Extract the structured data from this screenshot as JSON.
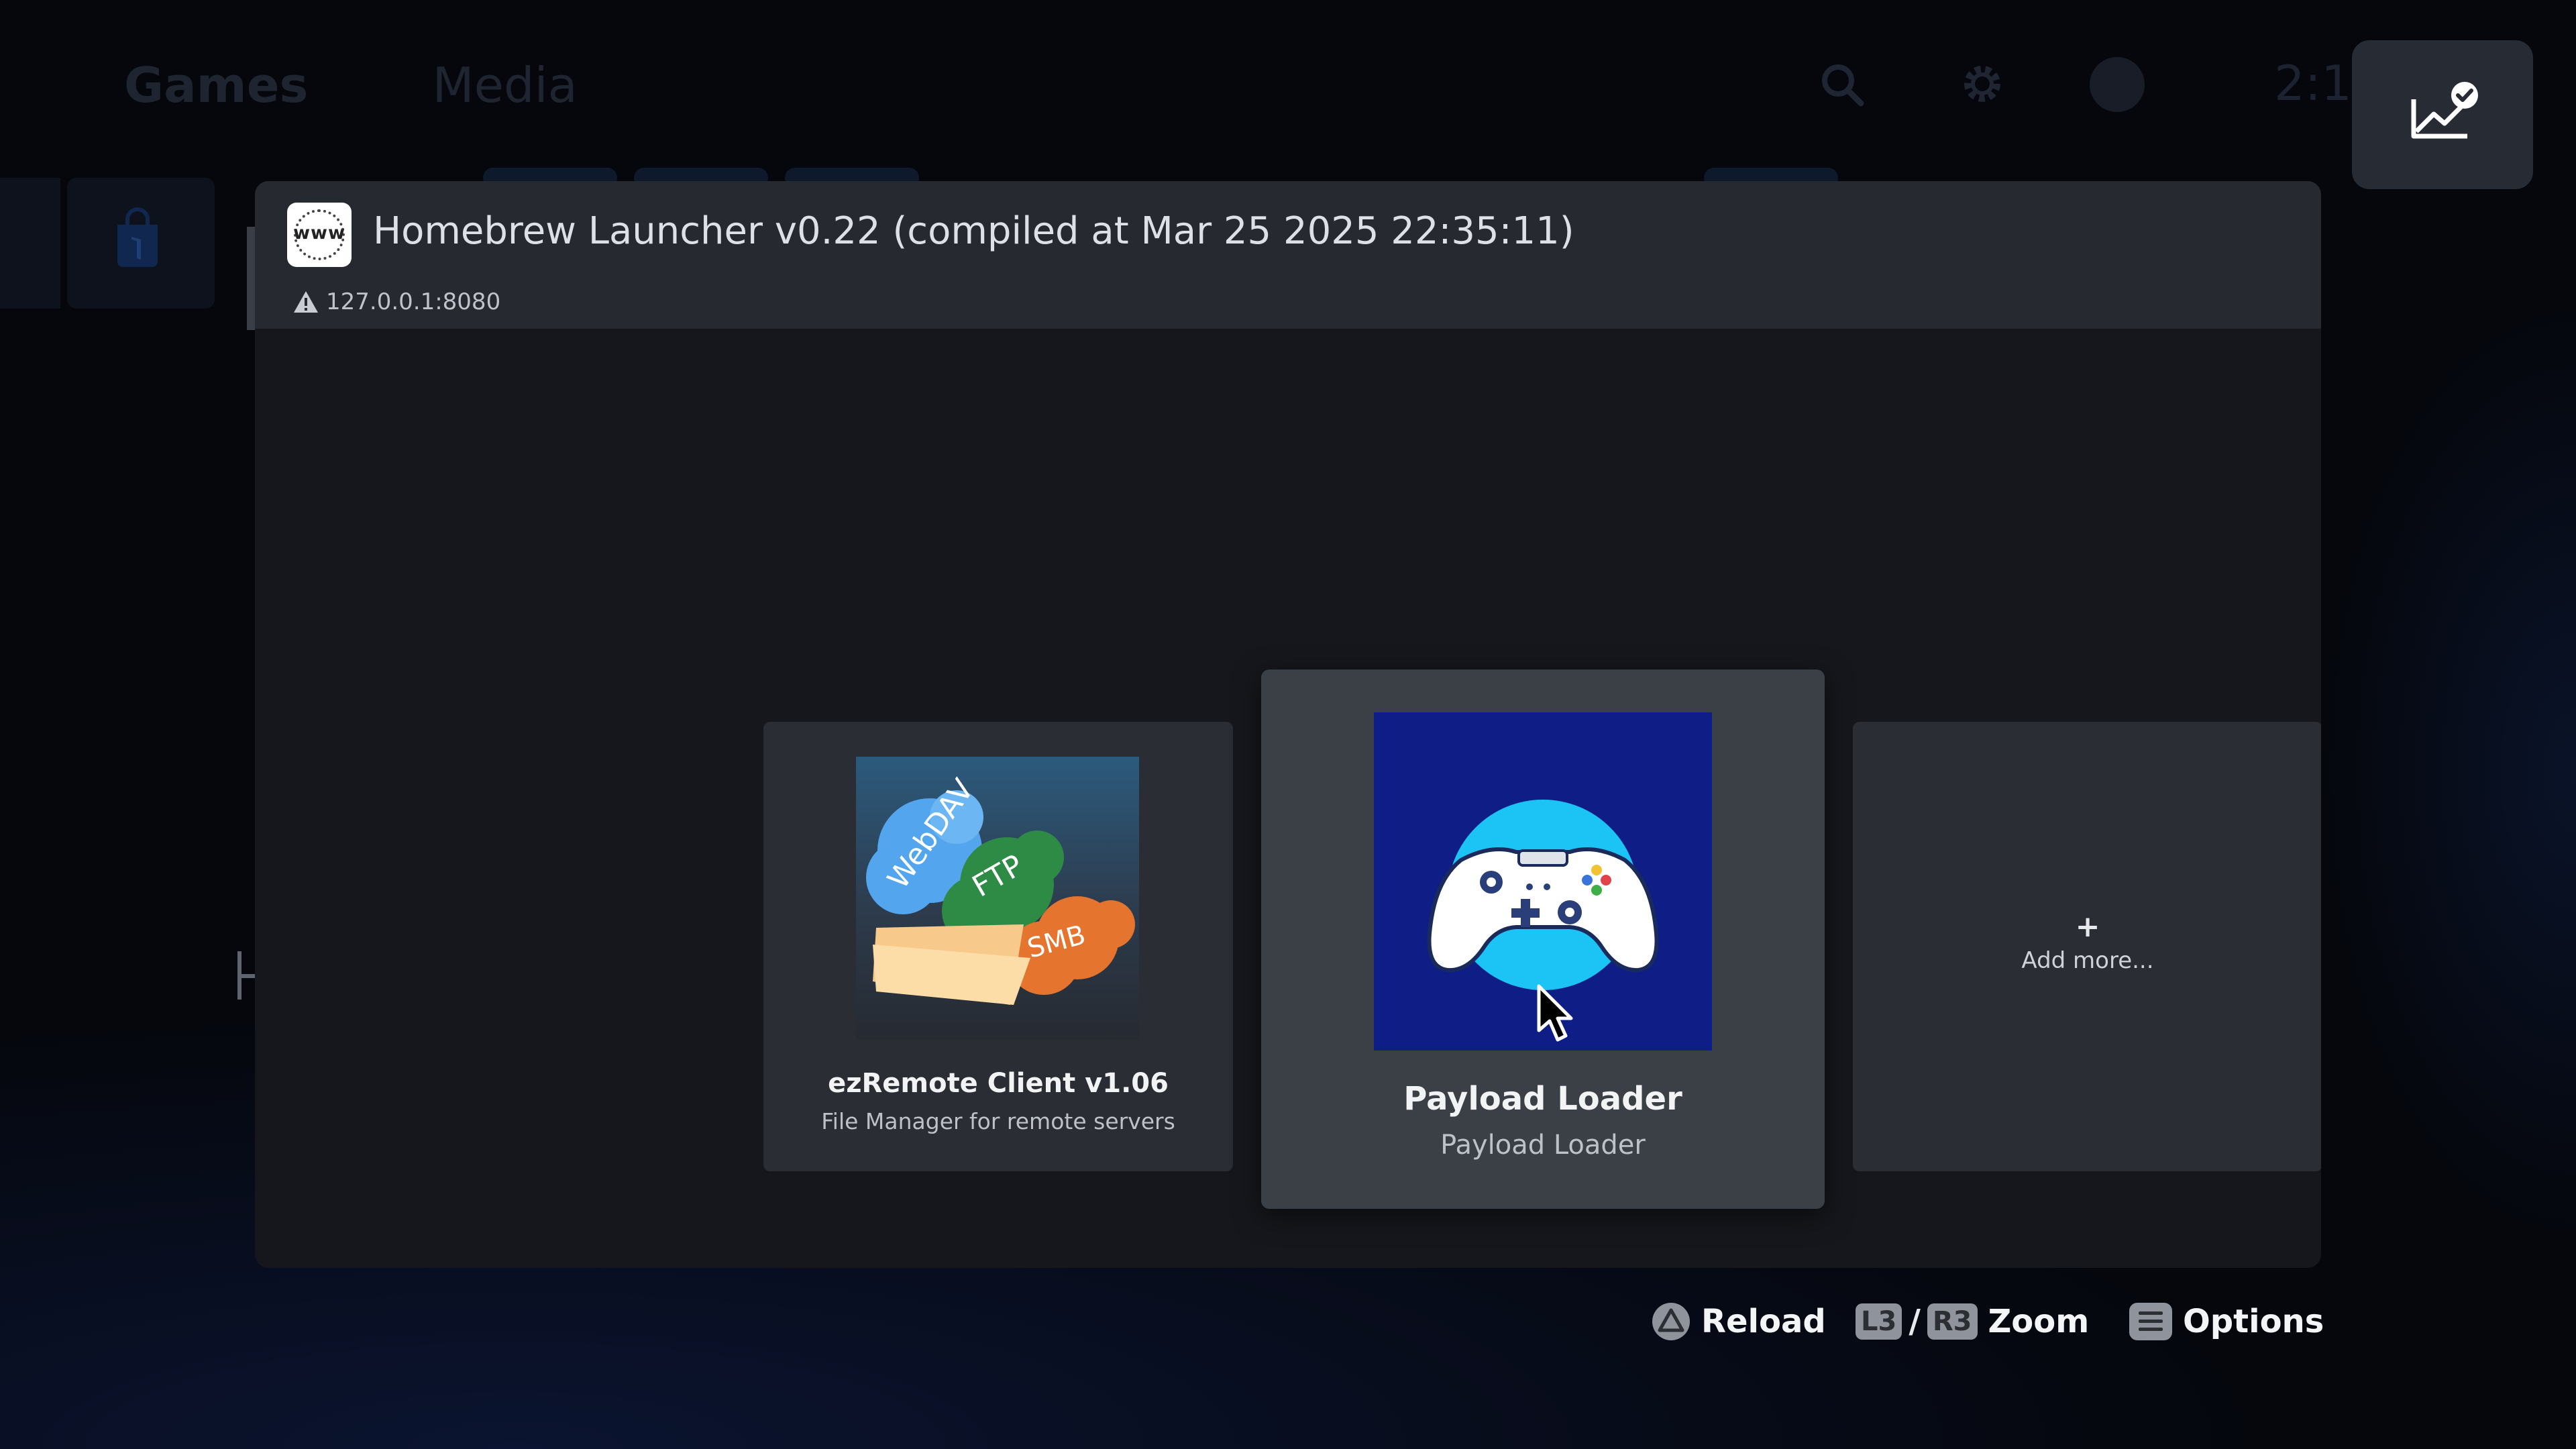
{
  "background": {
    "nav": {
      "games": "Games",
      "media": "Media"
    },
    "clock": "2:1"
  },
  "status_button": {
    "icon": "trend-check-icon"
  },
  "panel": {
    "title": "Homebrew Launcher v0.22 (compiled at Mar 25 2025 22:35:11)",
    "address": "127.0.0.1:8080",
    "logo_text": "www"
  },
  "cards": [
    {
      "title": "ezRemote Client v1.06",
      "subtitle": "File Manager for remote servers",
      "art_labels": [
        "WebDAV",
        "FTP",
        "SMB"
      ]
    },
    {
      "title": "Payload Loader",
      "subtitle": "Payload Loader"
    },
    {
      "plus": "+",
      "label": "Add more..."
    }
  ],
  "hints": {
    "reload": "Reload",
    "l3": "L3",
    "slash": "/",
    "r3": "R3",
    "zoom": "Zoom",
    "options": "Options"
  },
  "colors": {
    "background": "#05070d",
    "panel": "#15171c",
    "panel_header": "#262930",
    "card": "#2a2d33",
    "card_selected": "#3b3f46",
    "payload_art": "#0e1e86"
  }
}
